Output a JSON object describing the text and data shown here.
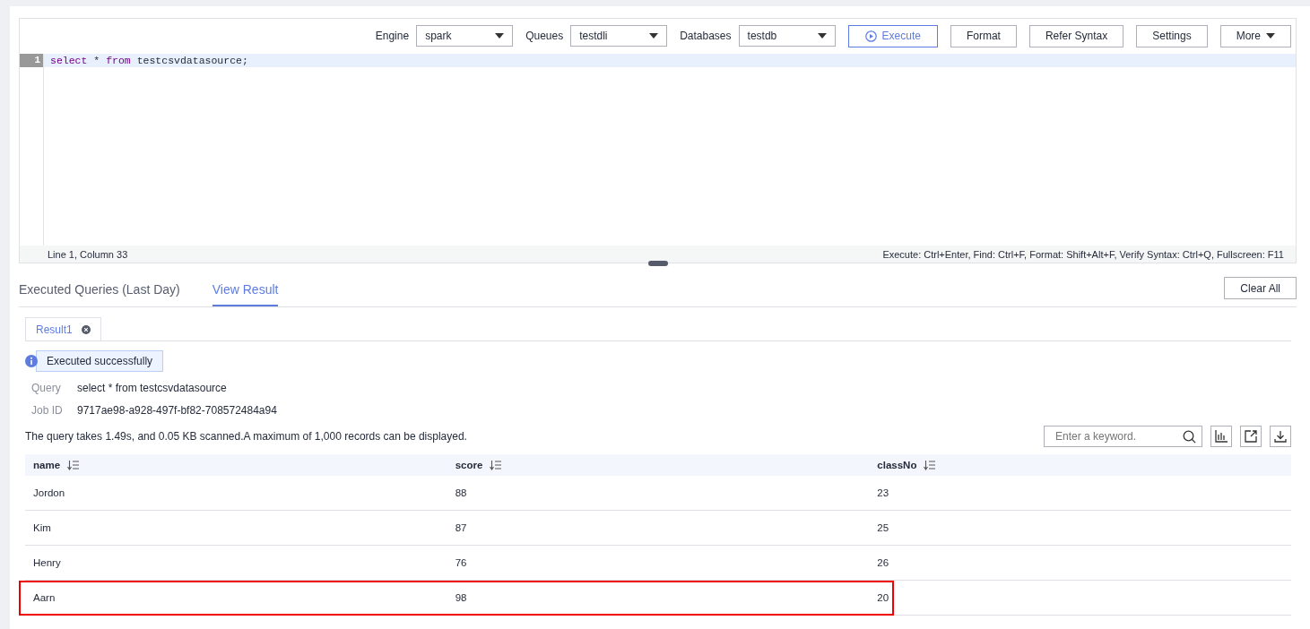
{
  "toolbar": {
    "selects": [
      {
        "label": "Engine",
        "value": "spark"
      },
      {
        "label": "Queues",
        "value": "testdli"
      },
      {
        "label": "Databases",
        "value": "testdb"
      }
    ],
    "buttons": [
      {
        "label": "Execute",
        "kind": "primary"
      },
      {
        "label": "Format",
        "kind": "plain"
      },
      {
        "label": "Refer Syntax",
        "kind": "plain"
      },
      {
        "label": "Settings",
        "kind": "plain"
      },
      {
        "label": "More",
        "kind": "menu"
      }
    ]
  },
  "editor": {
    "lines": [
      {
        "number": "1",
        "tokens": [
          {
            "text": "select",
            "kind": "keyword"
          },
          {
            "text": " * ",
            "kind": "plain"
          },
          {
            "text": "from",
            "kind": "keyword"
          },
          {
            "text": " testcsvdatasource;",
            "kind": "plain"
          }
        ]
      }
    ],
    "cursor_position": "Line 1, Column 33",
    "shortcuts": "Execute: Ctrl+Enter, Find: Ctrl+F, Format: Shift+Alt+F, Verify Syntax: Ctrl+Q, Fullscreen: F11"
  },
  "tabs": [
    {
      "label": "Executed Queries (Last Day)",
      "selected": false
    },
    {
      "label": "View Result",
      "selected": true
    }
  ],
  "clear_button": "Clear All",
  "result_tabs": [
    {
      "label": "Result1",
      "selected": true
    }
  ],
  "status_message": "Executed successfully",
  "details": [
    {
      "label": "Query",
      "value": "select * from testcsvdatasource"
    },
    {
      "label": "Job ID",
      "value": "9717ae98-a928-497f-bf82-708572484a94"
    }
  ],
  "summary": "The query takes 1.49s, and 0.05 KB scanned.A maximum of 1,000 records can be displayed.",
  "search": {
    "placeholder": "Enter a keyword."
  },
  "table": {
    "columns": [
      "name",
      "score",
      "classNo"
    ],
    "rows": [
      {
        "cells": [
          "Jordon",
          "88",
          "23"
        ],
        "highlighted": false
      },
      {
        "cells": [
          "Kim",
          "87",
          "25"
        ],
        "highlighted": false
      },
      {
        "cells": [
          "Henry",
          "76",
          "26"
        ],
        "highlighted": false
      },
      {
        "cells": [
          "Aarn",
          "98",
          "20"
        ],
        "highlighted": true
      }
    ]
  }
}
